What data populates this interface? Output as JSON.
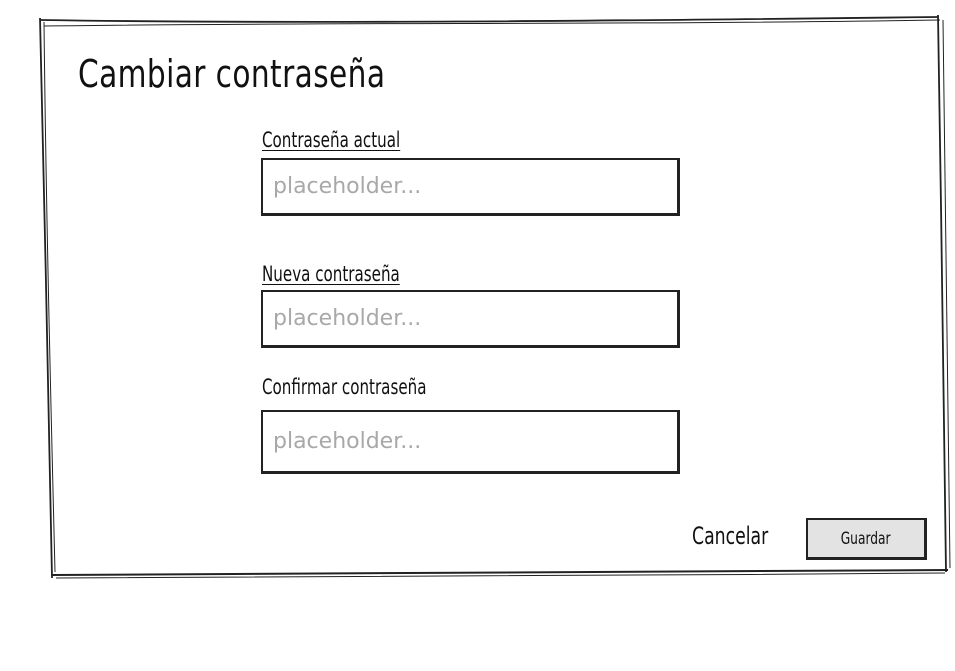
{
  "dialog": {
    "title": "Cambiar contraseña"
  },
  "fields": [
    {
      "label": "Contraseña actual",
      "placeholder": "placeholder...",
      "value": ""
    },
    {
      "label": "Nueva contraseña",
      "placeholder": "placeholder...",
      "value": ""
    },
    {
      "label": "Confirmar contraseña",
      "placeholder": "placeholder...",
      "value": ""
    }
  ],
  "actions": {
    "cancel_label": "Cancelar",
    "save_label": "Guardar"
  },
  "colors": {
    "border": "#222222",
    "placeholder": "#a8a8a8",
    "save_button_bg": "#e3e3e3"
  }
}
